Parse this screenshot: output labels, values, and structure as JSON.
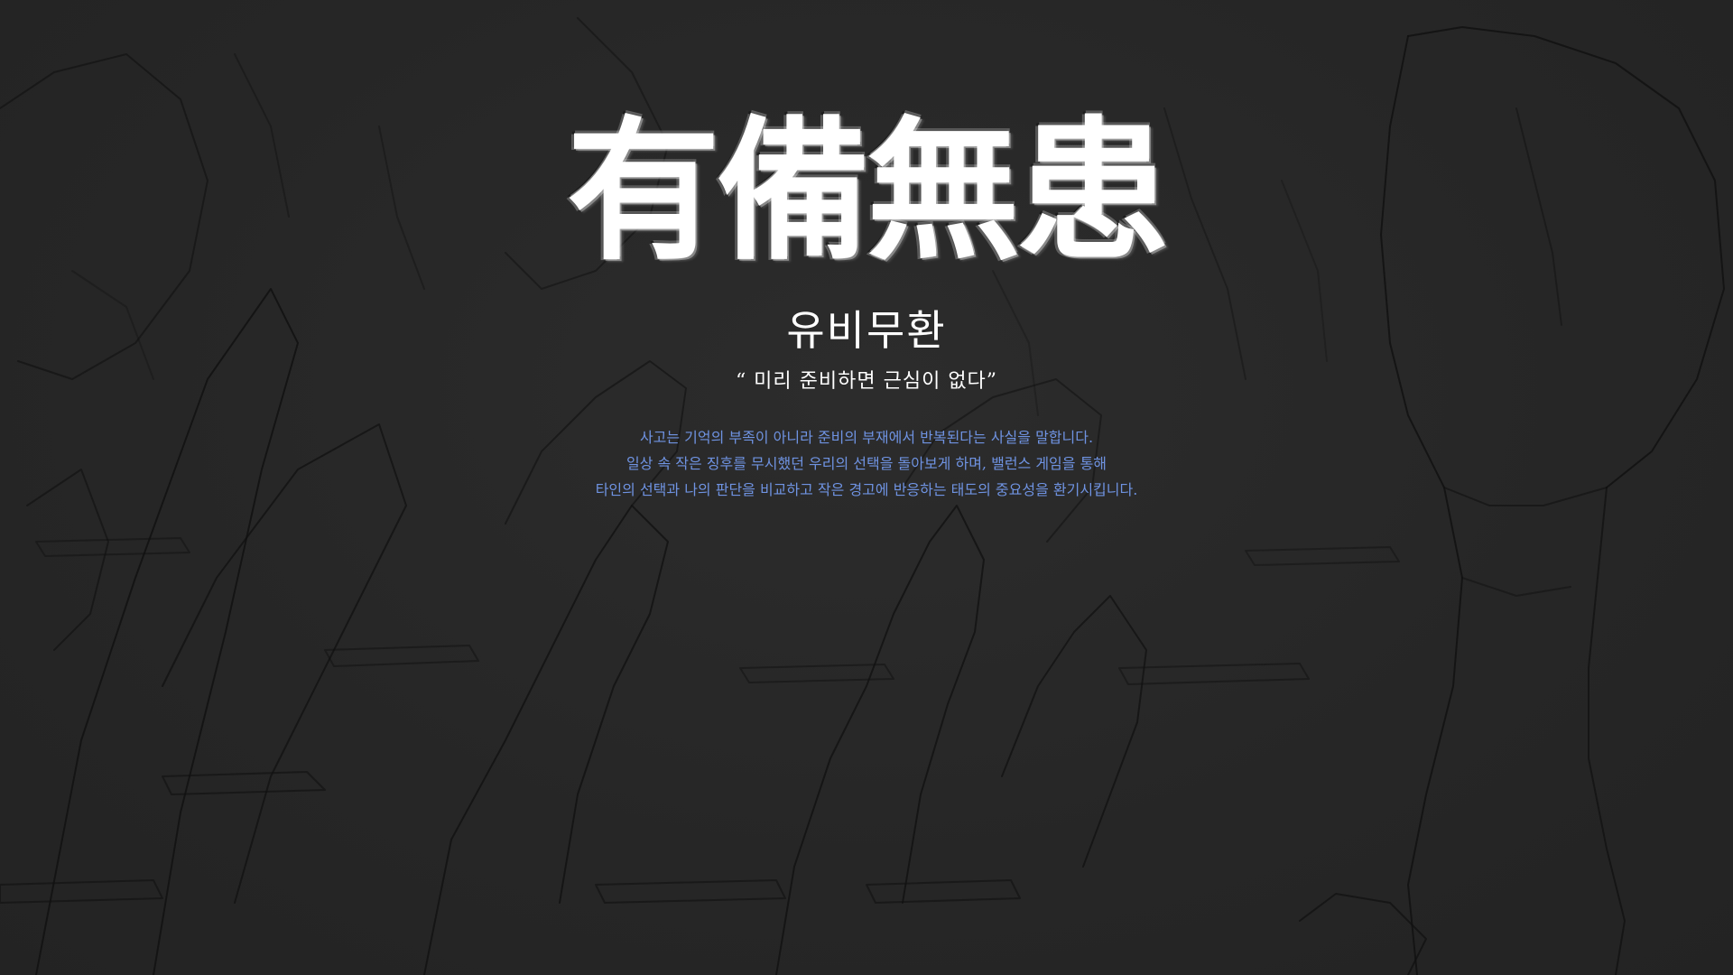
{
  "hero": {
    "hanja_title": "有備無患",
    "subtitle": "유비무환",
    "quote": "“ 미리 준비하면 근심이 없다”",
    "description_lines": [
      "사고는 기억의 부족이 아니라 준비의 부재에서 반복된다는 사실을 말합니다.",
      "일상 속 작은 징후를 무시했던 우리의 선택을 돌아보게 하며, 밸런스 게임을 통해",
      "타인의 선택과 나의 판단을 비교하고 작은 경고에 반응하는 태도의 중요성을 환기시킵니다."
    ]
  },
  "colors": {
    "background": "#272727",
    "title": "#f4f4f4",
    "description": "#6f93e2",
    "sketch_lines": "#0f0f0f"
  },
  "background_image": {
    "description_icon": "pedestrians-crossing-sketch"
  }
}
